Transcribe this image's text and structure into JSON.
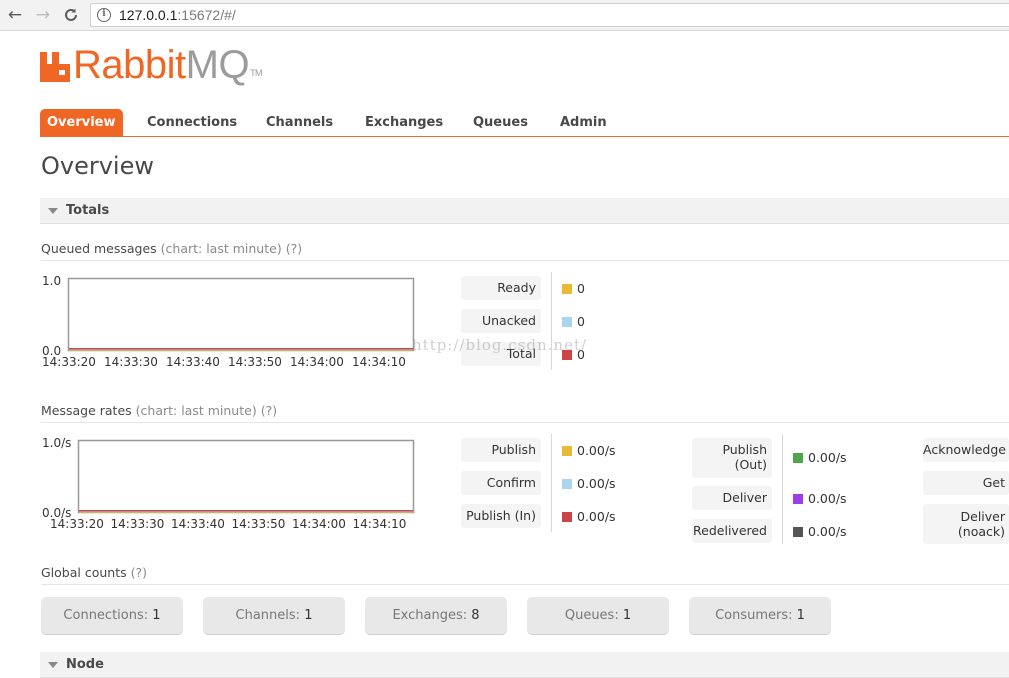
{
  "browser": {
    "url_host": "127.0.0.1",
    "url_rest": ":15672/#/"
  },
  "logo": {
    "rabbit": "Rabbit",
    "mq": "MQ",
    "tm": "TM"
  },
  "tabs": [
    {
      "label": "Overview",
      "active": true
    },
    {
      "label": "Connections",
      "active": false
    },
    {
      "label": "Channels",
      "active": false
    },
    {
      "label": "Exchanges",
      "active": false
    },
    {
      "label": "Queues",
      "active": false
    },
    {
      "label": "Admin",
      "active": false
    }
  ],
  "page_title": "Overview",
  "totals": {
    "title": "Totals",
    "queued": {
      "title": "Queued messages",
      "chart_note": "(chart: last minute)",
      "help": "(?)",
      "y_max_label": "1.0",
      "y_min_label": "0.0",
      "times": [
        "14:33:20",
        "14:33:30",
        "14:33:40",
        "14:33:50",
        "14:34:00",
        "14:34:10"
      ],
      "stats": [
        {
          "label": "Ready",
          "value": "0",
          "color": "#e8b934"
        },
        {
          "label": "Unacked",
          "value": "0",
          "color": "#aad4f2"
        },
        {
          "label": "Total",
          "value": "0",
          "color": "#cc4444"
        }
      ]
    },
    "rates": {
      "title": "Message rates",
      "chart_note": "(chart: last minute)",
      "help": "(?)",
      "y_max_label": "1.0/s",
      "y_min_label": "0.0/s",
      "times": [
        "14:33:20",
        "14:33:30",
        "14:33:40",
        "14:33:50",
        "14:34:00",
        "14:34:10"
      ],
      "col1": [
        {
          "label": "Publish",
          "value": "0.00/s",
          "color": "#e8b934"
        },
        {
          "label": "Confirm",
          "value": "0.00/s",
          "color": "#aad4f2"
        },
        {
          "label": "Publish (In)",
          "value": "0.00/s",
          "color": "#cc4444"
        }
      ],
      "col2": [
        {
          "label": "Publish\n(Out)",
          "value": "0.00/s",
          "color": "#4aa84a"
        },
        {
          "label": "Deliver",
          "value": "0.00/s",
          "color": "#9b3de8"
        },
        {
          "label": "Redelivered",
          "value": "0.00/s",
          "color": "#555555"
        }
      ],
      "col3": [
        {
          "label": "Acknowledge"
        },
        {
          "label": "Get"
        },
        {
          "label": "Deliver\n(noack)"
        }
      ]
    },
    "global": {
      "title": "Global counts",
      "help": "(?)",
      "counts": [
        {
          "label": "Connections:",
          "value": "1"
        },
        {
          "label": "Channels:",
          "value": "1"
        },
        {
          "label": "Exchanges:",
          "value": "8"
        },
        {
          "label": "Queues:",
          "value": "1"
        },
        {
          "label": "Consumers:",
          "value": "1"
        }
      ]
    }
  },
  "node_section": {
    "title": "Node"
  },
  "watermark": "http://blog.csdn.net/",
  "chart_data": [
    {
      "type": "line",
      "title": "Queued messages",
      "x": [
        "14:33:20",
        "14:33:30",
        "14:33:40",
        "14:33:50",
        "14:34:00",
        "14:34:10"
      ],
      "series": [
        {
          "name": "Ready",
          "values": [
            0,
            0,
            0,
            0,
            0,
            0
          ]
        },
        {
          "name": "Unacked",
          "values": [
            0,
            0,
            0,
            0,
            0,
            0
          ]
        },
        {
          "name": "Total",
          "values": [
            0,
            0,
            0,
            0,
            0,
            0
          ]
        }
      ],
      "ylim": [
        0.0,
        1.0
      ]
    },
    {
      "type": "line",
      "title": "Message rates",
      "x": [
        "14:33:20",
        "14:33:30",
        "14:33:40",
        "14:33:50",
        "14:34:00",
        "14:34:10"
      ],
      "series": [
        {
          "name": "Publish",
          "values": [
            0,
            0,
            0,
            0,
            0,
            0
          ]
        },
        {
          "name": "Confirm",
          "values": [
            0,
            0,
            0,
            0,
            0,
            0
          ]
        },
        {
          "name": "Publish (In)",
          "values": [
            0,
            0,
            0,
            0,
            0,
            0
          ]
        }
      ],
      "ylim": [
        0.0,
        1.0
      ]
    }
  ]
}
